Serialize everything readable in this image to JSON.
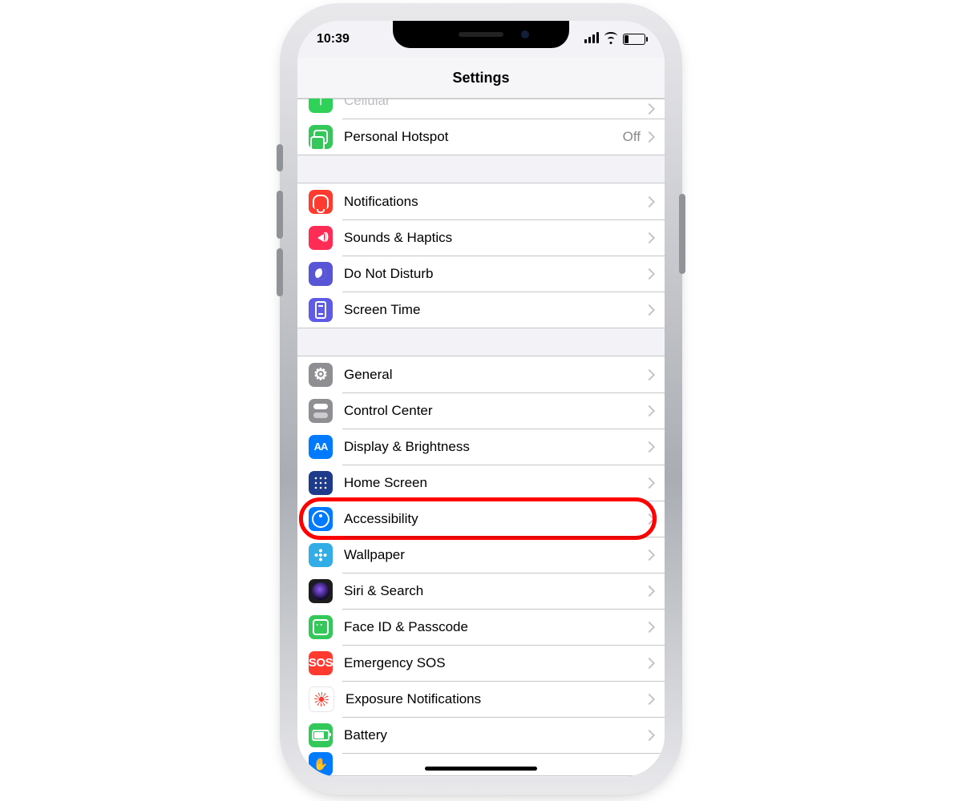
{
  "status": {
    "time": "10:39"
  },
  "header": {
    "title": "Settings"
  },
  "groups": [
    {
      "rows": [
        {
          "key": "cellular",
          "label": "Cellular",
          "icon": "antenna-icon",
          "bg": "bg-green2",
          "partial": true
        },
        {
          "key": "hotspot",
          "label": "Personal Hotspot",
          "value": "Off",
          "icon": "link-icon",
          "bg": "bg-green"
        }
      ]
    },
    {
      "rows": [
        {
          "key": "notifications",
          "label": "Notifications",
          "icon": "bell-icon",
          "bg": "bg-red"
        },
        {
          "key": "sounds",
          "label": "Sounds & Haptics",
          "icon": "speaker-icon",
          "bg": "bg-pink"
        },
        {
          "key": "dnd",
          "label": "Do Not Disturb",
          "icon": "moon-icon",
          "bg": "bg-purple"
        },
        {
          "key": "screentime",
          "label": "Screen Time",
          "icon": "hourglass-icon",
          "bg": "bg-indigo"
        }
      ]
    },
    {
      "rows": [
        {
          "key": "general",
          "label": "General",
          "icon": "gear-icon",
          "bg": "bg-gray"
        },
        {
          "key": "controlcenter",
          "label": "Control Center",
          "icon": "toggles-icon",
          "bg": "bg-gray"
        },
        {
          "key": "display",
          "label": "Display & Brightness",
          "icon": "aa-icon",
          "bg": "bg-blue"
        },
        {
          "key": "homescreen",
          "label": "Home Screen",
          "icon": "grid-icon",
          "bg": "bg-darkblue"
        },
        {
          "key": "accessibility",
          "label": "Accessibility",
          "icon": "accessibility-icon",
          "bg": "bg-blue",
          "highlight": true
        },
        {
          "key": "wallpaper",
          "label": "Wallpaper",
          "icon": "flower-icon",
          "bg": "bg-teal"
        },
        {
          "key": "siri",
          "label": "Siri & Search",
          "icon": "siri-icon",
          "bg": "bg-black"
        },
        {
          "key": "faceid",
          "label": "Face ID & Passcode",
          "icon": "faceid-icon",
          "bg": "bg-green"
        },
        {
          "key": "sos",
          "label": "Emergency SOS",
          "icon": "sos-icon",
          "bg": "bg-sos",
          "text": "SOS"
        },
        {
          "key": "exposure",
          "label": "Exposure Notifications",
          "icon": "exposure-icon",
          "bg": "bg-white"
        },
        {
          "key": "battery",
          "label": "Battery",
          "icon": "battery-icon",
          "bg": "bg-green"
        },
        {
          "key": "privacy",
          "label": "",
          "icon": "hand-icon",
          "bg": "bg-blue",
          "peek": true
        }
      ]
    }
  ]
}
